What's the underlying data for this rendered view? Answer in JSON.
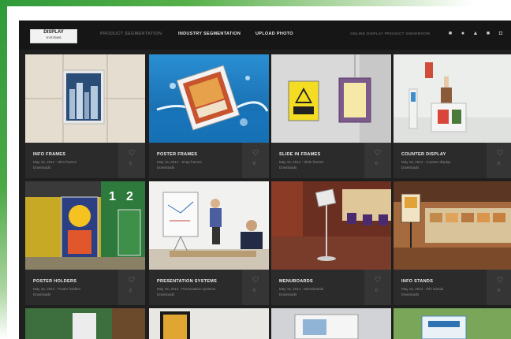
{
  "header": {
    "logo_top": "DISPLAY",
    "logo_bottom": "SYSTEMS",
    "nav": [
      "PRODUCT SEGMENTATION",
      "INDUSTRY SEGMENTATION",
      "UPLOAD PHOTO"
    ],
    "catalogue_link": "ONLINE DISPLAY PRODUCT SHOWROOM",
    "social_icons": [
      "facebook-icon",
      "pinterest-icon",
      "twitter-icon",
      "linkedin-icon",
      "instagram-icon"
    ]
  },
  "tiles": [
    {
      "title": "INFO FRAMES",
      "meta": "May 15, 2014 · Slim frames",
      "meta2": "Downloads",
      "likes": "0"
    },
    {
      "title": "POSTER FRAMES",
      "meta": "May 15, 2014 · Snap frames",
      "meta2": "Downloads",
      "likes": "0"
    },
    {
      "title": "SLIDE IN FRAMES",
      "meta": "May 15, 2014 · Slide frames",
      "meta2": "Downloads",
      "likes": "0"
    },
    {
      "title": "COUNTER DISPLAY",
      "meta": "May 15, 2014 · Counter display",
      "meta2": "Downloads",
      "likes": "0"
    },
    {
      "title": "POSTER HOLDERS",
      "meta": "May 15, 2014 · Poster holders",
      "meta2": "Downloads",
      "likes": "0"
    },
    {
      "title": "PRESENTATION SYSTEMS",
      "meta": "May 15, 2014 · Presentation systems",
      "meta2": "Downloads",
      "likes": "0"
    },
    {
      "title": "MENUBOARDS",
      "meta": "May 15, 2014 · Menuboards",
      "meta2": "Downloads",
      "likes": "0"
    },
    {
      "title": "INFO STANDS",
      "meta": "May 15, 2014 · Info stands",
      "meta2": "Downloads",
      "likes": "0"
    }
  ]
}
